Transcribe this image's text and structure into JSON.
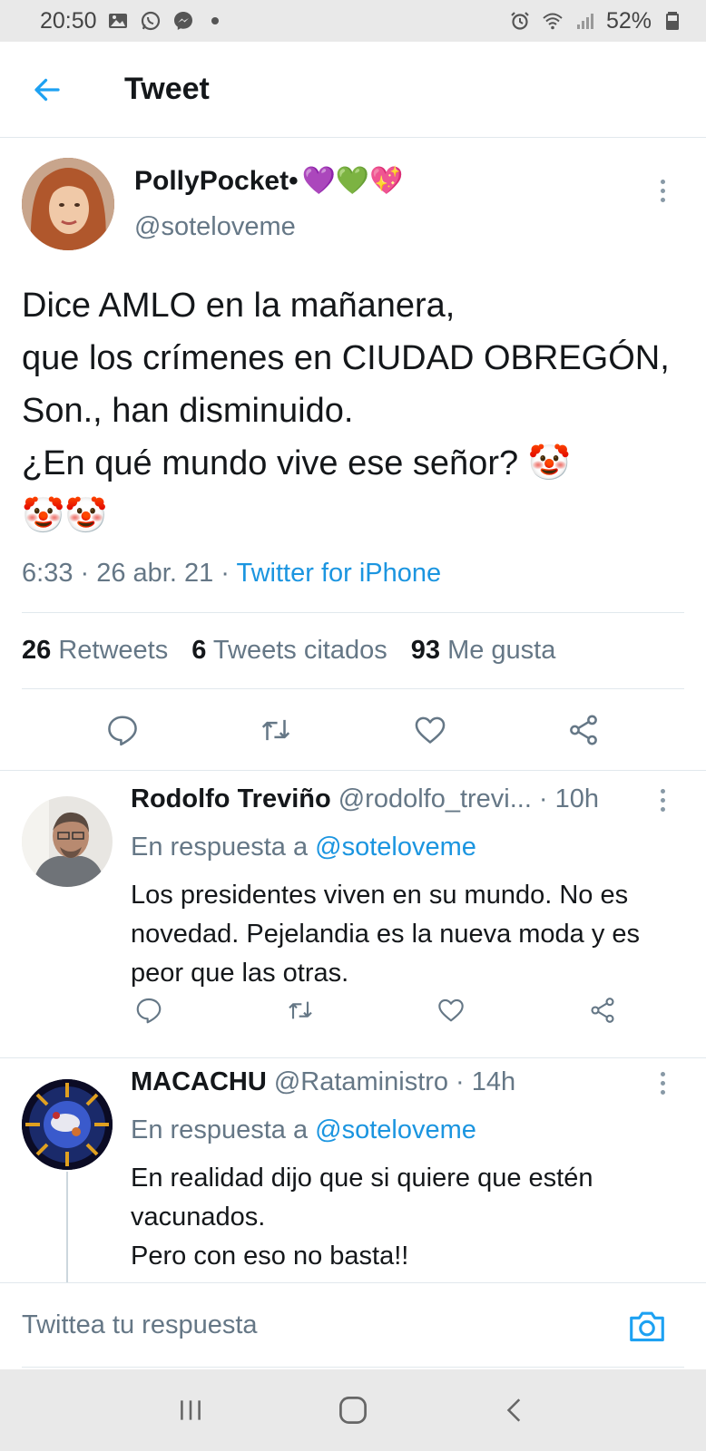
{
  "status_bar": {
    "time": "20:50",
    "battery": "52%",
    "icons": [
      "gallery-icon",
      "whatsapp-icon",
      "messenger-icon",
      "alarm-icon",
      "wifi-icon",
      "signal-icon",
      "battery-icon"
    ]
  },
  "header": {
    "title": "Tweet"
  },
  "main_tweet": {
    "author_name": "PollyPocket•",
    "author_emojis": "💜💚💖",
    "handle": "@soteloveme",
    "text": "Dice AMLO en la mañanera,\nque los crímenes en CIUDAD OBREGÓN, Son., han disminuido.\n¿En qué mundo vive ese señor? 🤡\n🤡🤡",
    "time": "6:33",
    "date": "26 abr. 21",
    "source": "Twitter for iPhone",
    "stats": {
      "retweets_count": "26",
      "retweets_label": "Retweets",
      "quotes_count": "6",
      "quotes_label": "Tweets citados",
      "likes_count": "93",
      "likes_label": "Me gusta"
    }
  },
  "replies": [
    {
      "name": "Rodolfo Treviño",
      "handle": "@rodolfo_trevi...",
      "age": "· 10h",
      "in_reply_prefix": "En respuesta a",
      "in_reply_to": "@soteloveme",
      "text": "Los presidentes viven en su mundo. No es novedad. Pejelandia es la nueva moda y es peor que las otras."
    },
    {
      "name": "MACACHU",
      "handle": "@Rataministro",
      "age": "· 14h",
      "in_reply_prefix": "En respuesta a",
      "in_reply_to": "@soteloveme",
      "text": "En realidad dijo que si quiere que estén vacunados.\nPero con eso no basta!!"
    }
  ],
  "compose": {
    "placeholder": "Twittea tu respuesta"
  },
  "colors": {
    "accent": "#1da1f2",
    "link": "#1b95e0",
    "secondary_text": "#657786",
    "divider": "#e1e8ed"
  }
}
